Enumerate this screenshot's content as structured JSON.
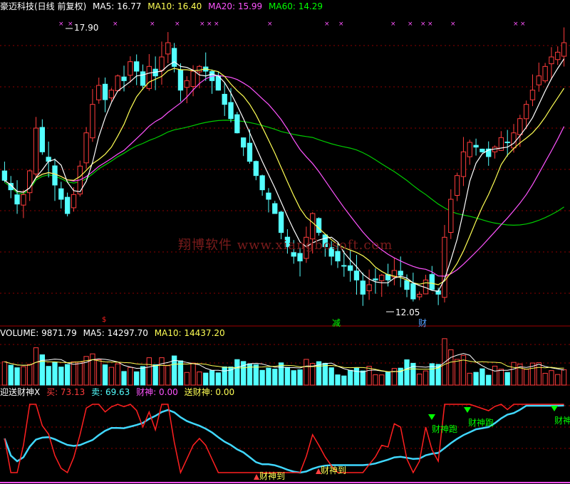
{
  "main_header": {
    "title": "豪迈科技(日线 前复权)",
    "ma5": "MA5: 16.77",
    "ma10": "MA10: 16.40",
    "ma20": "MA20: 15.99",
    "ma60": "MA60: 14.29"
  },
  "volume_header": {
    "label": "VOLUME: 9871.79",
    "ma5": "MA5: 14297.70",
    "ma10": "MA10: 14437.20"
  },
  "indicator_header": {
    "name": "迎送财神X",
    "buy": "买: 73.13",
    "sell": "卖: 69.63",
    "caishen": "财神: 0.00",
    "songcaishen": "送财神: 0.00"
  },
  "watermark": "翔博软件 www.xiangbosoft.com",
  "annotations": {
    "high_price": "17.90",
    "low_price": "12.05",
    "marker_reduce": "减",
    "marker_cai": "财",
    "marker_red": "$",
    "caishen_dao_1": "财神到",
    "caishen_dao_2": "财神到",
    "caishen_pao_1": "财神跑",
    "caishen_pao_2": "财神跑",
    "caishen_pao_3": "财神"
  },
  "colors": {
    "up": "#ff3c3c",
    "down": "#54ffff",
    "ma5": "#ffffff",
    "ma10": "#ffff54",
    "ma20": "#ff54ff",
    "ma60": "#00cc00",
    "indicator_buy": "#ff2020",
    "indicator_sell": "#40d8ff",
    "grid": "#8b0000"
  },
  "chart_data": {
    "type": "candlestick",
    "panels": [
      "price",
      "volume",
      "indicator"
    ],
    "high": 17.9,
    "low": 12.05,
    "ma_values": {
      "MA5": 16.77,
      "MA10": 16.4,
      "MA20": 15.99,
      "MA60": 14.29
    },
    "volume_values": {
      "VOLUME": 9871.79,
      "MA5": 14297.7,
      "MA10": 14437.2
    },
    "indicator_values": {
      "买": 73.13,
      "卖": 69.63,
      "财神": 0.0,
      "送财神": 0.0
    },
    "closes": [
      14.7,
      14.5,
      14.2,
      14.4,
      14.9,
      15.8,
      15.3,
      15.1,
      14.6,
      14.3,
      14.0,
      14.4,
      15.0,
      15.7,
      16.3,
      16.7,
      16.4,
      16.6,
      16.9,
      16.8,
      17.2,
      17.0,
      16.7,
      17.1,
      16.9,
      17.3,
      17.6,
      17.1,
      16.6,
      16.8,
      17.0,
      17.1,
      17.0,
      16.8,
      16.6,
      16.3,
      16.0,
      15.7,
      15.4,
      15.1,
      14.8,
      14.5,
      14.3,
      14.0,
      13.6,
      13.3,
      13.1,
      13.0,
      13.5,
      14.0,
      13.6,
      13.3,
      13.1,
      13.0,
      12.9,
      12.8,
      12.6,
      12.3,
      12.5,
      12.6,
      12.7,
      12.6,
      12.8,
      12.7,
      12.4,
      12.2,
      12.3,
      12.6,
      12.4,
      12.3,
      13.5,
      14.3,
      14.8,
      15.3,
      15.5,
      15.4,
      15.3,
      15.2,
      15.4,
      15.6,
      15.5,
      15.7,
      16.0,
      16.3,
      16.6,
      16.9,
      17.1,
      17.3,
      17.4,
      17.6
    ],
    "volume_scale": [
      0,
      60000
    ],
    "indicator_scale": [
      0,
      100
    ]
  }
}
